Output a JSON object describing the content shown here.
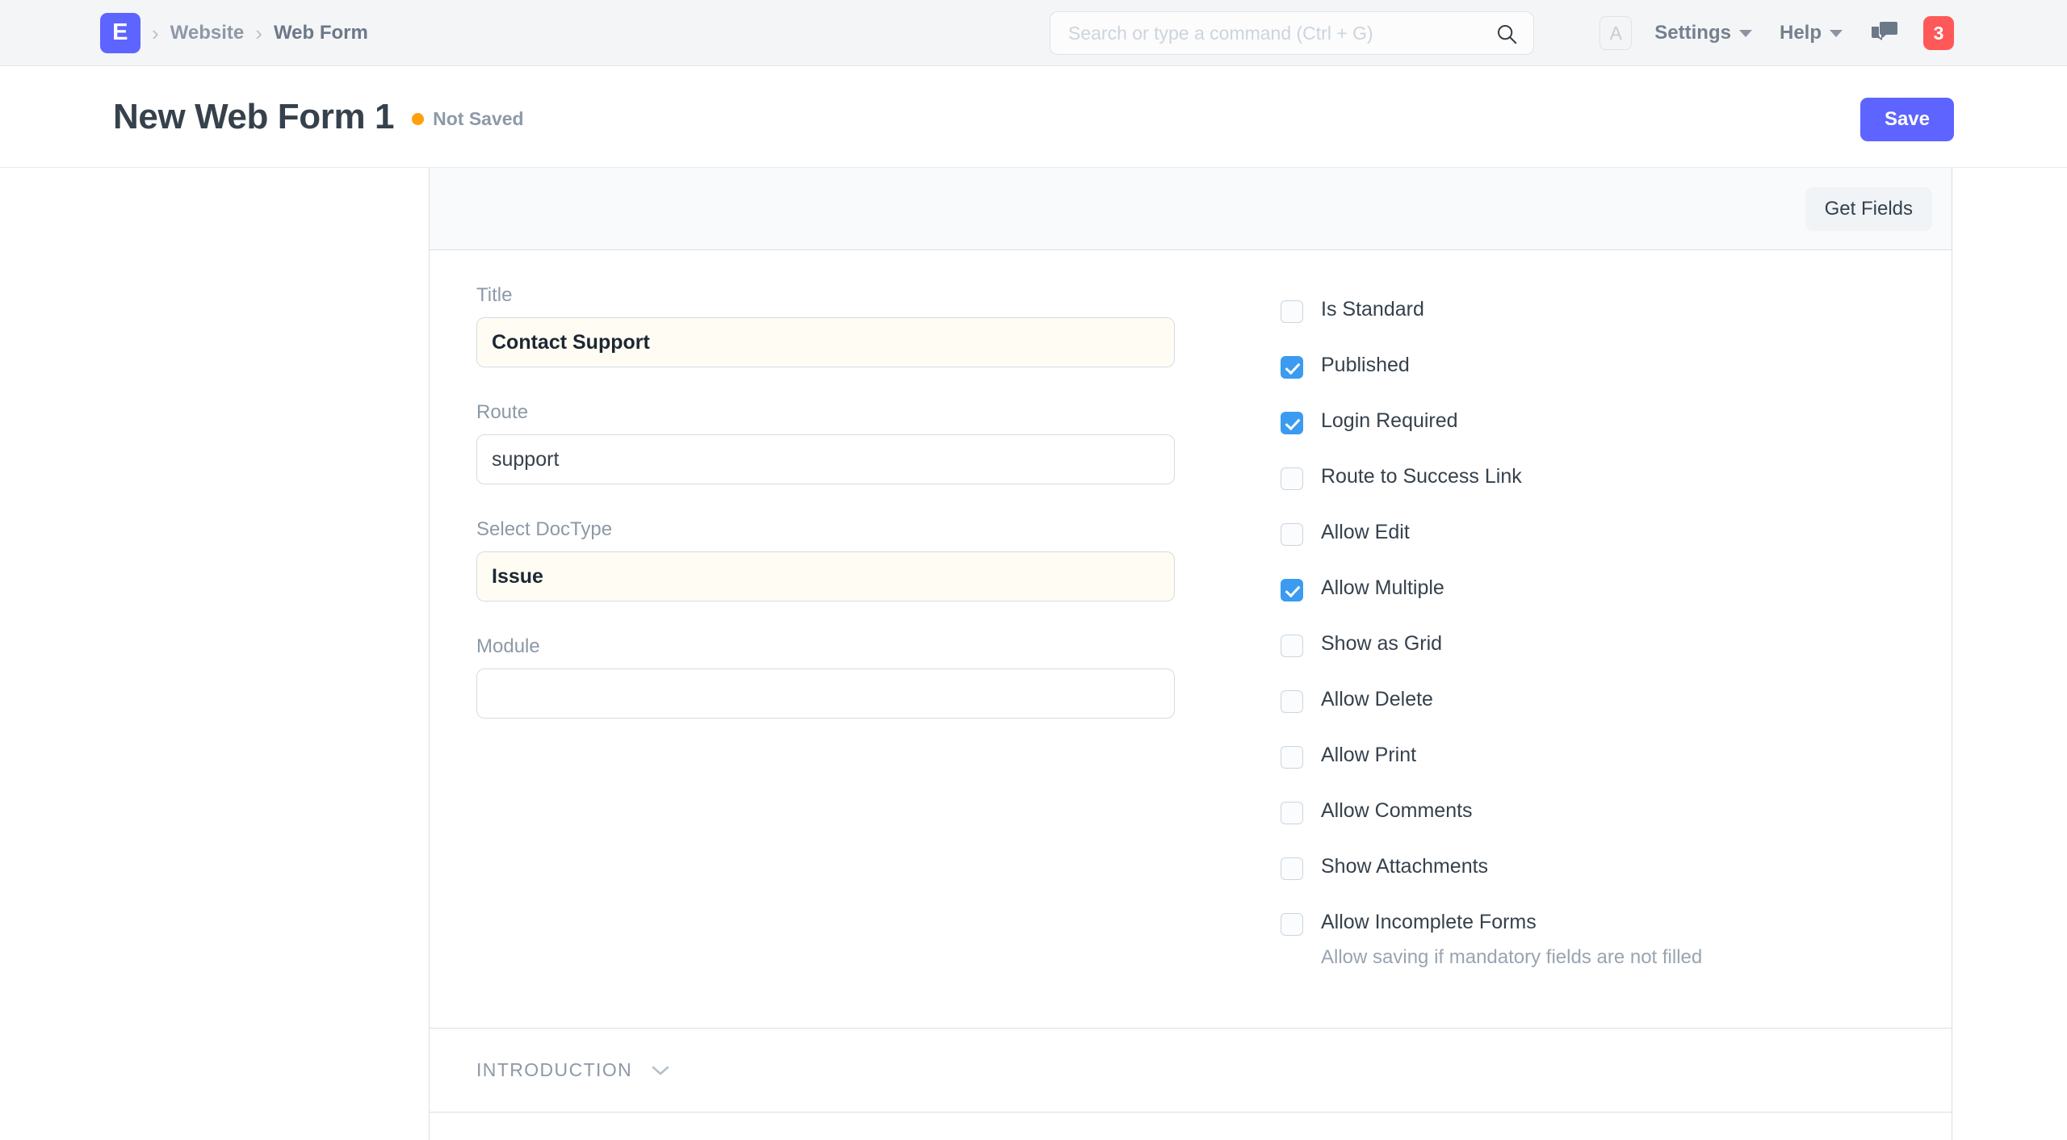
{
  "navbar": {
    "logo_letter": "E",
    "logo_color": "#5e64ff",
    "breadcrumbs": [
      {
        "label": "Website"
      },
      {
        "label": "Web Form"
      }
    ],
    "search": {
      "value": "",
      "placeholder": "Search or type a command (Ctrl + G)",
      "icon": "search-icon"
    },
    "avatar_letter": "A",
    "menus": [
      {
        "label": "Settings"
      },
      {
        "label": "Help"
      }
    ],
    "chat_icon": "chat-bubbles-icon",
    "notification_count": "3",
    "notification_color": "#ff5858"
  },
  "page_head": {
    "title": "New Web Form 1",
    "status": "Not Saved",
    "status_color": "#ffa00a",
    "save_label": "Save",
    "save_color": "#5e64ff"
  },
  "toolbar": {
    "get_fields_label": "Get Fields"
  },
  "form": {
    "fields": [
      {
        "label": "Title",
        "value": "Contact Support",
        "placeholder": "",
        "mandatory": true
      },
      {
        "label": "Route",
        "value": "support",
        "placeholder": "",
        "mandatory": false
      },
      {
        "label": "Select DocType",
        "value": "Issue",
        "placeholder": "",
        "mandatory": true
      },
      {
        "label": "Module",
        "value": "",
        "placeholder": "",
        "mandatory": false
      }
    ],
    "checkboxes": [
      {
        "label": "Is Standard",
        "checked": false
      },
      {
        "label": "Published",
        "checked": true
      },
      {
        "label": "Login Required",
        "checked": true
      },
      {
        "label": "Route to Success Link",
        "checked": false
      },
      {
        "label": "Allow Edit",
        "checked": false
      },
      {
        "label": "Allow Multiple",
        "checked": true
      },
      {
        "label": "Show as Grid",
        "checked": false
      },
      {
        "label": "Allow Delete",
        "checked": false
      },
      {
        "label": "Allow Print",
        "checked": false
      },
      {
        "label": "Allow Comments",
        "checked": false
      },
      {
        "label": "Show Attachments",
        "checked": false
      },
      {
        "label": "Allow Incomplete Forms",
        "checked": false,
        "description": "Allow saving if mandatory fields are not filled"
      }
    ],
    "checkbox_checked_color": "#3a9bf0"
  },
  "sections": [
    {
      "title": "INTRODUCTION",
      "collapsed": true,
      "chevron": "chevron-down-icon"
    }
  ]
}
